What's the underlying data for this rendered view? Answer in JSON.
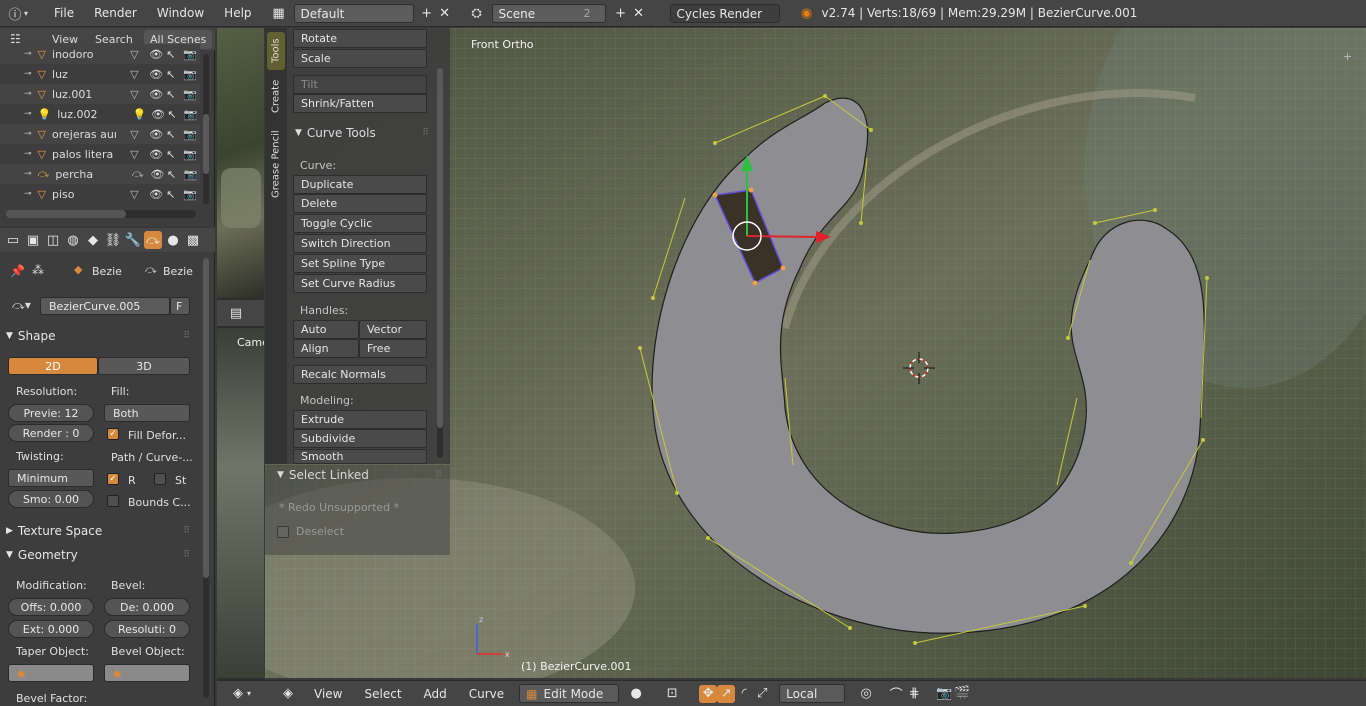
{
  "topbar": {
    "menus": [
      "File",
      "Render",
      "Window",
      "Help"
    ],
    "layout": "Default",
    "scene": "Scene",
    "scene_count": "2",
    "render_engine": "Cycles Render",
    "stats": "v2.74 | Verts:18/69 | Mem:29.29M | BezierCurve.001"
  },
  "outliner": {
    "tabs": [
      "View",
      "Search",
      "All Scenes"
    ],
    "items": [
      {
        "name": "inodoro",
        "icon": "mesh-icon"
      },
      {
        "name": "luz",
        "icon": "mesh-icon"
      },
      {
        "name": "luz.001",
        "icon": "mesh-icon"
      },
      {
        "name": "luz.002",
        "icon": "lamp-icon"
      },
      {
        "name": "orejeras auricul",
        "icon": "mesh-icon"
      },
      {
        "name": "palos litera",
        "icon": "mesh-icon"
      },
      {
        "name": "percha",
        "icon": "curve-icon"
      },
      {
        "name": "piso",
        "icon": "mesh-icon"
      }
    ]
  },
  "properties": {
    "context_1": "Bezie",
    "context_2": "Bezie",
    "datablock": "BezierCurve.005",
    "fake_user": "F",
    "shape_header": "Shape",
    "dim_2d": "2D",
    "dim_3d": "3D",
    "resolution_label": "Resolution:",
    "fill_label": "Fill:",
    "preview_res": "Previe:  12",
    "render_res": "Render :  0",
    "fill_value": "Both",
    "fill_deform": "Fill Defor...",
    "twisting_label": "Twisting:",
    "path_label": "Path / Curve-...",
    "twist_method": "Minimum",
    "smooth": "Smo:  0.00",
    "radius_chk": "R",
    "stretch_chk": "St",
    "bounds_chk": "Bounds C...",
    "texture_space": "Texture Space",
    "geometry_header": "Geometry",
    "modification_label": "Modification:",
    "bevel_label": "Bevel:",
    "offset": "Offs: 0.000",
    "depth": "De:  0.000",
    "extrude": "Ext:  0.000",
    "resolution_bevel": "Resoluti:  0",
    "taper_label": "Taper Object:",
    "bevel_obj_label": "Bevel Object:",
    "bevel_factor": "Bevel Factor:"
  },
  "midstrip": {
    "camera_label": "Came"
  },
  "toolshelf": {
    "tabs": [
      "Tools",
      "Create",
      "Grease Pencil"
    ],
    "top_buttons": [
      "Rotate",
      "Scale"
    ],
    "tilt": "Tilt",
    "shrink": "Shrink/Fatten",
    "curve_tools_header": "Curve Tools",
    "curve_label": "Curve:",
    "curve_buttons": [
      "Duplicate",
      "Delete",
      "Toggle Cyclic",
      "Switch Direction",
      "Set Spline Type",
      "Set Curve Radius"
    ],
    "handles_label": "Handles:",
    "handle_auto": "Auto",
    "handle_vector": "Vector",
    "handle_align": "Align",
    "handle_free": "Free",
    "recalc": "Recalc Normals",
    "modeling_label": "Modeling:",
    "modeling_buttons": [
      "Extrude",
      "Subdivide",
      "Smooth"
    ]
  },
  "operator": {
    "header": "Select Linked",
    "redo": "* Redo Unsupported *",
    "deselect": "Deselect"
  },
  "view3d": {
    "view_name": "Front Ortho",
    "object_info": "(1) BezierCurve.001"
  },
  "bottombar": {
    "menus": [
      "View",
      "Select",
      "Add",
      "Curve"
    ],
    "mode": "Edit Mode",
    "pivot": "Local"
  },
  "colors": {
    "accent": "#d6893c",
    "curve_fill": "#8e8e92",
    "handle": "#c8c83a"
  }
}
